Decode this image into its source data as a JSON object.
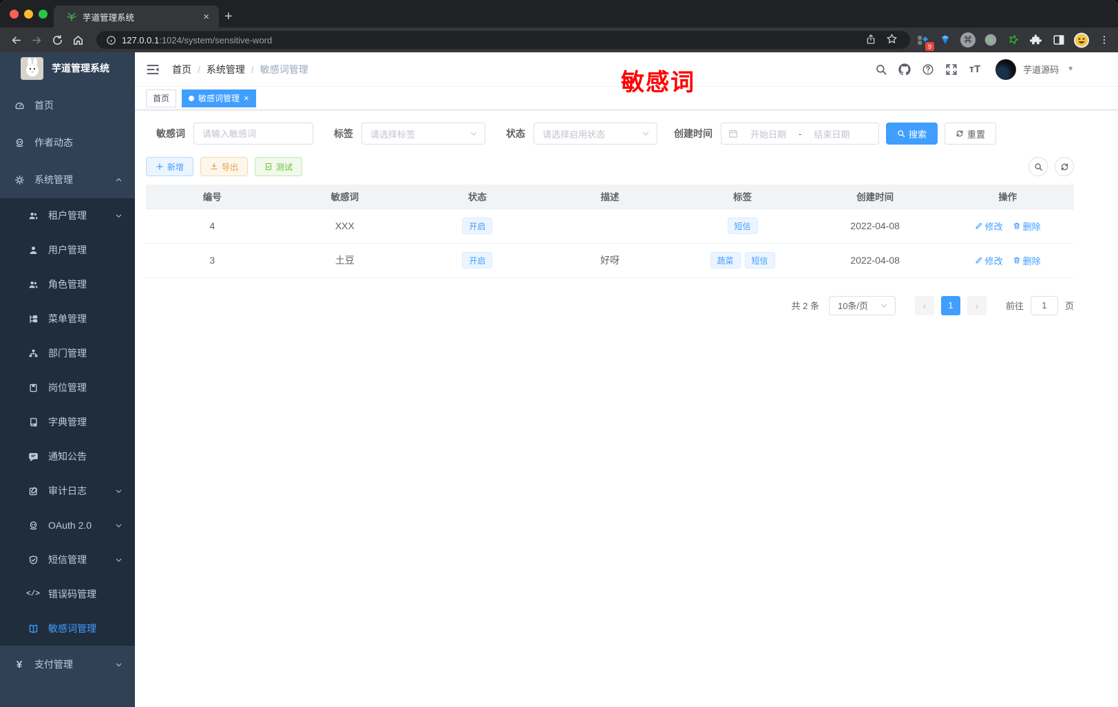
{
  "browser": {
    "tab_title": "芋道管理系统",
    "url_host": "127.0.0.1",
    "url_path": ":1024/system/sensitive-word",
    "ext_badge": "9"
  },
  "annotation": {
    "text": "敏感词",
    "color": "#ff0000"
  },
  "sidebar": {
    "logo_title": "芋道管理系统",
    "items": [
      {
        "key": "home",
        "icon": "dashboard",
        "label": "首页",
        "level": 1
      },
      {
        "key": "author-news",
        "icon": "chat",
        "label": "作者动态",
        "level": 1
      },
      {
        "key": "system",
        "icon": "gear",
        "label": "系统管理",
        "level": 1,
        "arrow": "up"
      },
      {
        "key": "tenant",
        "icon": "users",
        "label": "租户管理",
        "level": 2,
        "arrow": "down"
      },
      {
        "key": "user",
        "icon": "user",
        "label": "用户管理",
        "level": 2
      },
      {
        "key": "role",
        "icon": "users",
        "label": "角色管理",
        "level": 2
      },
      {
        "key": "menu",
        "icon": "tree",
        "label": "菜单管理",
        "level": 2
      },
      {
        "key": "dept",
        "icon": "org",
        "label": "部门管理",
        "level": 2
      },
      {
        "key": "post",
        "icon": "badge",
        "label": "岗位管理",
        "level": 2
      },
      {
        "key": "dict",
        "icon": "book",
        "label": "字典管理",
        "level": 2
      },
      {
        "key": "notice",
        "icon": "comment",
        "label": "通知公告",
        "level": 2
      },
      {
        "key": "audit-log",
        "icon": "edit",
        "label": "审计日志",
        "level": 2,
        "arrow": "down"
      },
      {
        "key": "oauth",
        "icon": "chat",
        "label": "OAuth 2.0",
        "level": 2,
        "arrow": "down"
      },
      {
        "key": "sms",
        "icon": "shield",
        "label": "短信管理",
        "level": 2,
        "arrow": "down"
      },
      {
        "key": "error-code",
        "icon": "code",
        "label": "错误码管理",
        "level": 2
      },
      {
        "key": "sensitive-word",
        "icon": "openbook",
        "label": "敏感词管理",
        "level": 2,
        "active": true
      },
      {
        "key": "pay",
        "icon": "yen",
        "label": "支付管理",
        "level": 1,
        "arrow": "down"
      }
    ]
  },
  "navbar": {
    "breadcrumb": [
      "首页",
      "系统管理",
      "敏感词管理"
    ],
    "username": "芋道源码"
  },
  "tags_view": [
    {
      "label": "首页",
      "active": false,
      "closable": false
    },
    {
      "label": "敏感词管理",
      "active": true,
      "closable": true
    }
  ],
  "filters": {
    "keyword_label": "敏感词",
    "keyword_placeholder": "请输入敏感词",
    "tag_label": "标签",
    "tag_placeholder": "请选择标签",
    "status_label": "状态",
    "status_placeholder": "请选择启用状态",
    "date_label": "创建时间",
    "date_start_placeholder": "开始日期",
    "date_separator": "-",
    "date_end_placeholder": "结束日期",
    "search_label": "搜索",
    "reset_label": "重置"
  },
  "toolbar": {
    "add": "新增",
    "export": "导出",
    "test": "测试"
  },
  "table": {
    "columns": [
      "编号",
      "敏感词",
      "状态",
      "描述",
      "标签",
      "创建时间",
      "操作"
    ],
    "rows": [
      {
        "id": "4",
        "word": "XXX",
        "status": "开启",
        "description": "",
        "tags": [
          "短信"
        ],
        "created": "2022-04-08",
        "edit": "修改",
        "delete": "删除"
      },
      {
        "id": "3",
        "word": "土豆",
        "status": "开启",
        "description": "好呀",
        "tags": [
          "蔬菜",
          "短信"
        ],
        "created": "2022-04-08",
        "edit": "修改",
        "delete": "删除"
      }
    ]
  },
  "pagination": {
    "total": "共 2 条",
    "page_size": "10条/页",
    "current_page": "1",
    "goto_label": "前往",
    "goto_value": "1",
    "page_suffix": "页"
  },
  "colors": {
    "primary": "#409eff",
    "sidebar_bg": "#304156",
    "submenu_bg": "#1f2d3d",
    "warning": "#e6a23c",
    "success": "#67c23a",
    "annotation_red": "#ff0000"
  }
}
